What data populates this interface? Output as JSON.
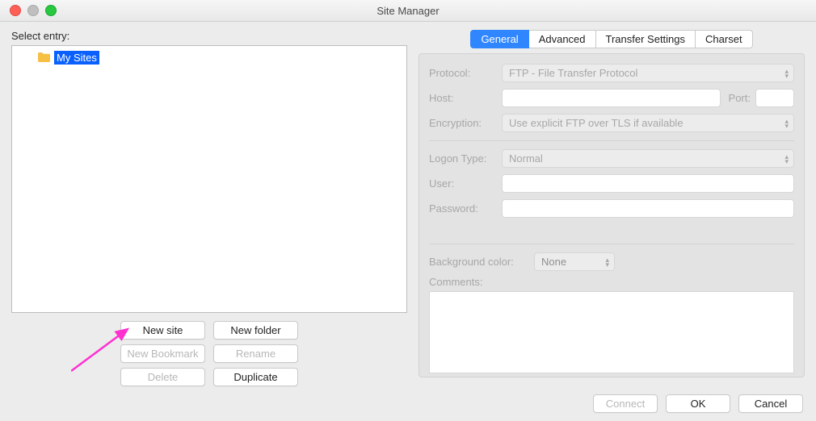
{
  "window": {
    "title": "Site Manager"
  },
  "left": {
    "select_label": "Select entry:",
    "root_node": "My Sites",
    "buttons": {
      "new_site": "New site",
      "new_folder": "New folder",
      "new_bookmark": "New Bookmark",
      "rename": "Rename",
      "delete": "Delete",
      "duplicate": "Duplicate"
    }
  },
  "tabs": {
    "general": "General",
    "advanced": "Advanced",
    "transfer": "Transfer Settings",
    "charset": "Charset"
  },
  "form": {
    "protocol_label": "Protocol:",
    "protocol_value": "FTP - File Transfer Protocol",
    "host_label": "Host:",
    "port_label": "Port:",
    "encryption_label": "Encryption:",
    "encryption_value": "Use explicit FTP over TLS if available",
    "logon_label": "Logon Type:",
    "logon_value": "Normal",
    "user_label": "User:",
    "password_label": "Password:",
    "bgcolor_label": "Background color:",
    "bgcolor_value": "None",
    "comments_label": "Comments:"
  },
  "footer": {
    "connect": "Connect",
    "ok": "OK",
    "cancel": "Cancel"
  }
}
